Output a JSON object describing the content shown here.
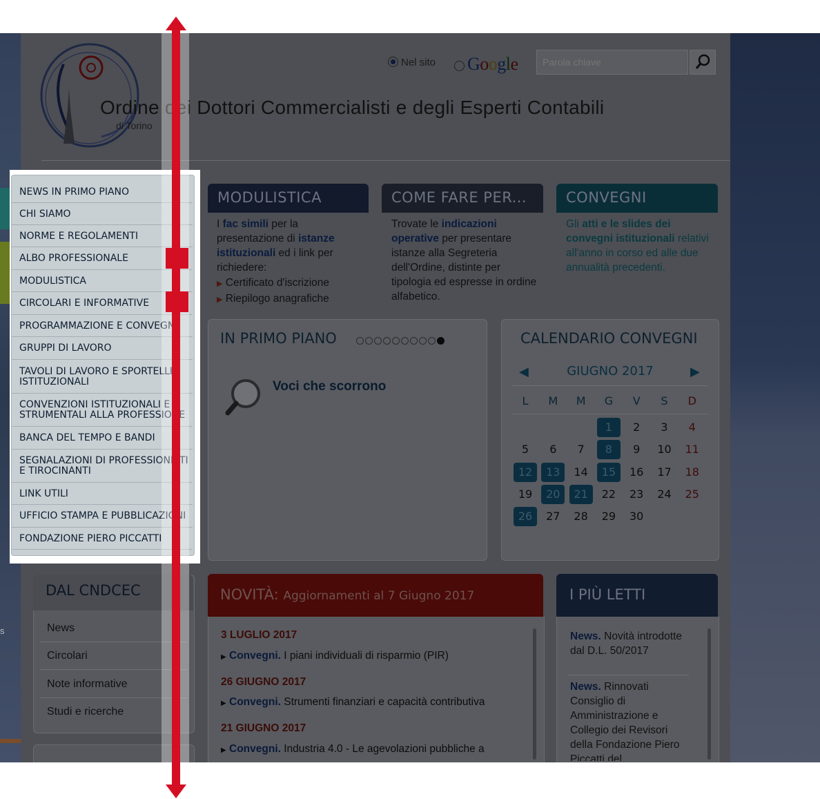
{
  "header": {
    "title": "Ordine dei Dottori Commercialisti e degli Esperti Contabili",
    "subtitle": "di Torino"
  },
  "search": {
    "option_site": "Nel sito",
    "option_google": "Google",
    "placeholder": "Parola chiave"
  },
  "nav_menu": [
    "NEWS  IN PRIMO PIANO",
    "CHI SIAMO",
    "NORME E REGOLAMENTI",
    "ALBO PROFESSIONALE",
    "MODULISTICA",
    "CIRCOLARI E INFORMATIVE",
    "PROGRAMMAZIONE E CONVEGNI",
    "GRUPPI DI LAVORO",
    "TAVOLI DI LAVORO E SPORTELLI ISTITUZIONALI",
    "CONVENZIONI ISTITUZIONALI E STRUMENTALI ALLA PROFESSIONE",
    "BANCA DEL TEMPO E BANDI",
    "SEGNALAZIONI DI PROFESSIONISTI E TIROCINANTI",
    "LINK UTILI",
    "UFFICIO STAMPA E PUBBLICAZIONI",
    "FONDAZIONE PIERO PICCATTI"
  ],
  "modulistica": {
    "title": "MODULISTICA",
    "t1": "I ",
    "t2": "fac simili",
    "t3": " per la presentazione di ",
    "t4": "istanze istituzionali",
    "t5": " ed i link per richiedere:",
    "bullet1": "Certificato d'iscrizione",
    "bullet2": "Riepilogo anagrafiche"
  },
  "come_fare": {
    "title": "COME FARE PER...",
    "t1": "Trovate le ",
    "t2": "indicazioni operative",
    "t3": " per presentare istanze alla Segreteria dell'Ordine, distinte per tipologia ed espresse in ordine alfabetico."
  },
  "convegni": {
    "title": "CONVEGNI",
    "t1": "Gli ",
    "t2": "atti e le slides dei convegni istituzionali",
    "t3": " relativi all'anno in corso ed alle due annualità precedenti."
  },
  "primo_piano": {
    "title": "IN PRIMO PIANO",
    "slide_text": "Voci che scorrono",
    "dots_total": 10,
    "dots_active": 9
  },
  "calendar": {
    "title": "CALENDARIO CONVEGNI",
    "month": "GIUGNO 2017",
    "weekdays": [
      "L",
      "M",
      "M",
      "G",
      "V",
      "S",
      "D"
    ],
    "weeks": [
      [
        "",
        "",
        "",
        "1",
        "2",
        "3",
        "4"
      ],
      [
        "5",
        "6",
        "7",
        "8",
        "9",
        "10",
        "11"
      ],
      [
        "12",
        "13",
        "14",
        "15",
        "16",
        "17",
        "18"
      ],
      [
        "19",
        "20",
        "21",
        "22",
        "23",
        "24",
        "25"
      ],
      [
        "26",
        "27",
        "28",
        "29",
        "30",
        "",
        ""
      ]
    ],
    "event_days": [
      "1",
      "8",
      "12",
      "13",
      "15",
      "20",
      "21",
      "26"
    ]
  },
  "novita": {
    "title": "NOVITÀ:",
    "subtitle": "Aggiornamenti al 7 Giugno 2017",
    "groups": [
      {
        "date": "3 LUGLIO 2017",
        "cat": "Convegni.",
        "text": "I piani individuali di risparmio (PIR)"
      },
      {
        "date": "26 GIUGNO 2017",
        "cat": "Convegni.",
        "text": "Strumenti finanziari e capacità contributiva"
      },
      {
        "date": "21 GIUGNO 2017",
        "cat": "Convegni.",
        "text": "Industria 4.0 - Le agevolazioni pubbliche a"
      }
    ]
  },
  "piu_letti": {
    "title": "I PIÙ LETTI",
    "items": [
      {
        "cat": "News.",
        "text": "Novità introdotte dal D.L. 50/2017"
      },
      {
        "cat": "News.",
        "text": "Rinnovati Consiglio di Amministrazione e Collegio dei Revisori della Fondazione Piero Piccatti del"
      }
    ]
  },
  "cndcec": {
    "title": "DAL CNDCEC",
    "items": [
      "News",
      "Circolari",
      "Note informative",
      "Studi e ricerche"
    ]
  },
  "left_edge_text": "s",
  "colors": {
    "brand_navy": "#1b2a4a",
    "teal": "#0b8fa8",
    "red": "#c0281c",
    "arrow": "#d40f23",
    "overlay": "#4d4f54"
  },
  "icons": [
    "logo-emblem-icon",
    "search-icon",
    "magnifier-icon",
    "prev-arrow-icon",
    "next-arrow-icon",
    "bullet-arrow-icon"
  ]
}
